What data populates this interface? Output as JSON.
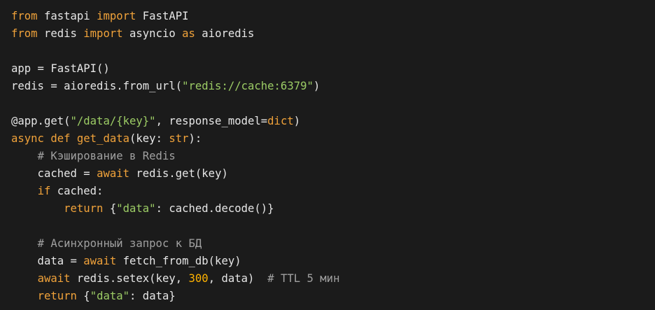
{
  "code": {
    "language": "python",
    "background": "#1b1b1b",
    "colors": {
      "keyword": "#f0a23a",
      "string": "#9ccc65",
      "number": "#ffb300",
      "comment": "#a0a0a0",
      "text": "#e6e6e6"
    },
    "lines": [
      [
        {
          "t": "kw",
          "v": "from"
        },
        {
          "t": "plain",
          "v": " fastapi "
        },
        {
          "t": "kw",
          "v": "import"
        },
        {
          "t": "plain",
          "v": " FastAPI"
        }
      ],
      [
        {
          "t": "kw",
          "v": "from"
        },
        {
          "t": "plain",
          "v": " redis "
        },
        {
          "t": "kw",
          "v": "import"
        },
        {
          "t": "plain",
          "v": " asyncio "
        },
        {
          "t": "kw",
          "v": "as"
        },
        {
          "t": "plain",
          "v": " aioredis"
        }
      ],
      [],
      [
        {
          "t": "plain",
          "v": "app = FastAPI()"
        }
      ],
      [
        {
          "t": "plain",
          "v": "redis = aioredis.from_url("
        },
        {
          "t": "str",
          "v": "\"redis://cache:6379\""
        },
        {
          "t": "plain",
          "v": ")"
        }
      ],
      [],
      [
        {
          "t": "plain",
          "v": "@app.get("
        },
        {
          "t": "str",
          "v": "\"/data/{key}\""
        },
        {
          "t": "plain",
          "v": ", response_model="
        },
        {
          "t": "kw",
          "v": "dict"
        },
        {
          "t": "plain",
          "v": ")"
        }
      ],
      [
        {
          "t": "kw",
          "v": "async"
        },
        {
          "t": "plain",
          "v": " "
        },
        {
          "t": "kw",
          "v": "def"
        },
        {
          "t": "plain",
          "v": " "
        },
        {
          "t": "kw",
          "v": "get_data"
        },
        {
          "t": "plain",
          "v": "(key: "
        },
        {
          "t": "kw",
          "v": "str"
        },
        {
          "t": "plain",
          "v": "):"
        }
      ],
      [
        {
          "t": "plain",
          "v": "    "
        },
        {
          "t": "com",
          "v": "# Кэширование в Redis"
        }
      ],
      [
        {
          "t": "plain",
          "v": "    cached = "
        },
        {
          "t": "kw",
          "v": "await"
        },
        {
          "t": "plain",
          "v": " redis.get(key)"
        }
      ],
      [
        {
          "t": "plain",
          "v": "    "
        },
        {
          "t": "kw",
          "v": "if"
        },
        {
          "t": "plain",
          "v": " cached:"
        }
      ],
      [
        {
          "t": "plain",
          "v": "        "
        },
        {
          "t": "kw",
          "v": "return"
        },
        {
          "t": "plain",
          "v": " {"
        },
        {
          "t": "str",
          "v": "\"data\""
        },
        {
          "t": "plain",
          "v": ": cached.decode()}"
        }
      ],
      [],
      [
        {
          "t": "plain",
          "v": "    "
        },
        {
          "t": "com",
          "v": "# Асинхронный запрос к БД"
        }
      ],
      [
        {
          "t": "plain",
          "v": "    data = "
        },
        {
          "t": "kw",
          "v": "await"
        },
        {
          "t": "plain",
          "v": " fetch_from_db(key)"
        }
      ],
      [
        {
          "t": "plain",
          "v": "    "
        },
        {
          "t": "kw",
          "v": "await"
        },
        {
          "t": "plain",
          "v": " redis.setex(key, "
        },
        {
          "t": "num",
          "v": "300"
        },
        {
          "t": "plain",
          "v": ", data)  "
        },
        {
          "t": "com",
          "v": "# TTL 5 мин"
        }
      ],
      [
        {
          "t": "plain",
          "v": "    "
        },
        {
          "t": "kw",
          "v": "return"
        },
        {
          "t": "plain",
          "v": " {"
        },
        {
          "t": "str",
          "v": "\"data\""
        },
        {
          "t": "plain",
          "v": ": data}"
        }
      ]
    ]
  }
}
